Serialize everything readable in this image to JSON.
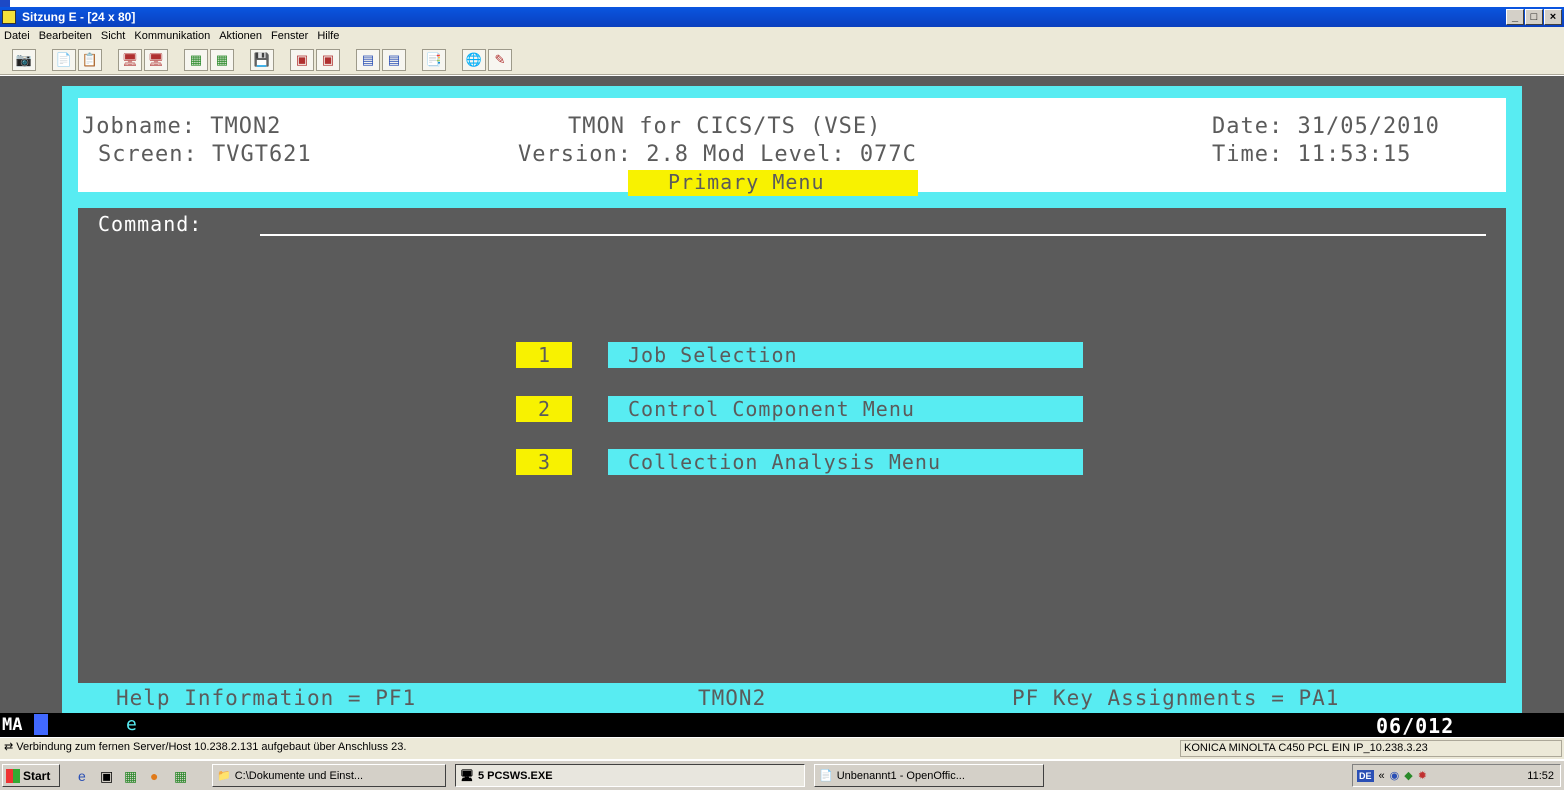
{
  "window": {
    "title": "Sitzung E - [24 x 80]",
    "controls": [
      "_",
      "□",
      "×"
    ]
  },
  "menubar": [
    "Datei",
    "Bearbeiten",
    "Sicht",
    "Kommunikation",
    "Aktionen",
    "Fenster",
    "Hilfe"
  ],
  "toolbar": {
    "groups": [
      [
        "📷"
      ],
      [
        "📄",
        "📋"
      ],
      [
        "🖥",
        "🖥"
      ],
      [
        "▦",
        "▦"
      ],
      [
        "💾"
      ],
      [
        "▣",
        "▣"
      ],
      [
        "▤",
        "▤"
      ],
      [
        "📑"
      ],
      [
        "🌐",
        "✎"
      ]
    ]
  },
  "screen": {
    "jobname": "Jobname: TMON2",
    "product": "TMON for CICS/TS (VSE)",
    "date": "Date: 31/05/2010",
    "screen_id": "Screen: TVGT621",
    "version": "Version: 2.8 Mod Level: 077C",
    "time": "Time: 11:53:15",
    "menu_title": "Primary Menu",
    "command_label": "Command:",
    "command_value": "",
    "options": [
      {
        "num": "1",
        "label": "Job Selection"
      },
      {
        "num": "2",
        "label": "Control Component Menu"
      },
      {
        "num": "3",
        "label": "Collection Analysis Menu"
      }
    ],
    "footer_help": "Help Information = PF1",
    "footer_job": "TMON2",
    "footer_keys": "PF Key Assignments = PA1"
  },
  "oia": {
    "mode": "MA",
    "indicator": "e",
    "cursor_pos": "06/012"
  },
  "statusbar": {
    "connection": "Verbindung zum fernen Server/Host 10.238.2.131 aufgebaut über Anschluss 23.",
    "printer": "KONICA MINOLTA C450 PCL EIN IP_10.238.3.23"
  },
  "taskbar": {
    "start_label": "Start",
    "tasks": [
      {
        "label": "C:\\Dokumente und Einst...",
        "icon": "📁"
      },
      {
        "label": "5 PCSWS.EXE",
        "icon": "🖥"
      },
      {
        "label": "Unbenannt1 - OpenOffic...",
        "icon": "📄"
      }
    ],
    "lang": "DE",
    "clock": "11:52"
  }
}
